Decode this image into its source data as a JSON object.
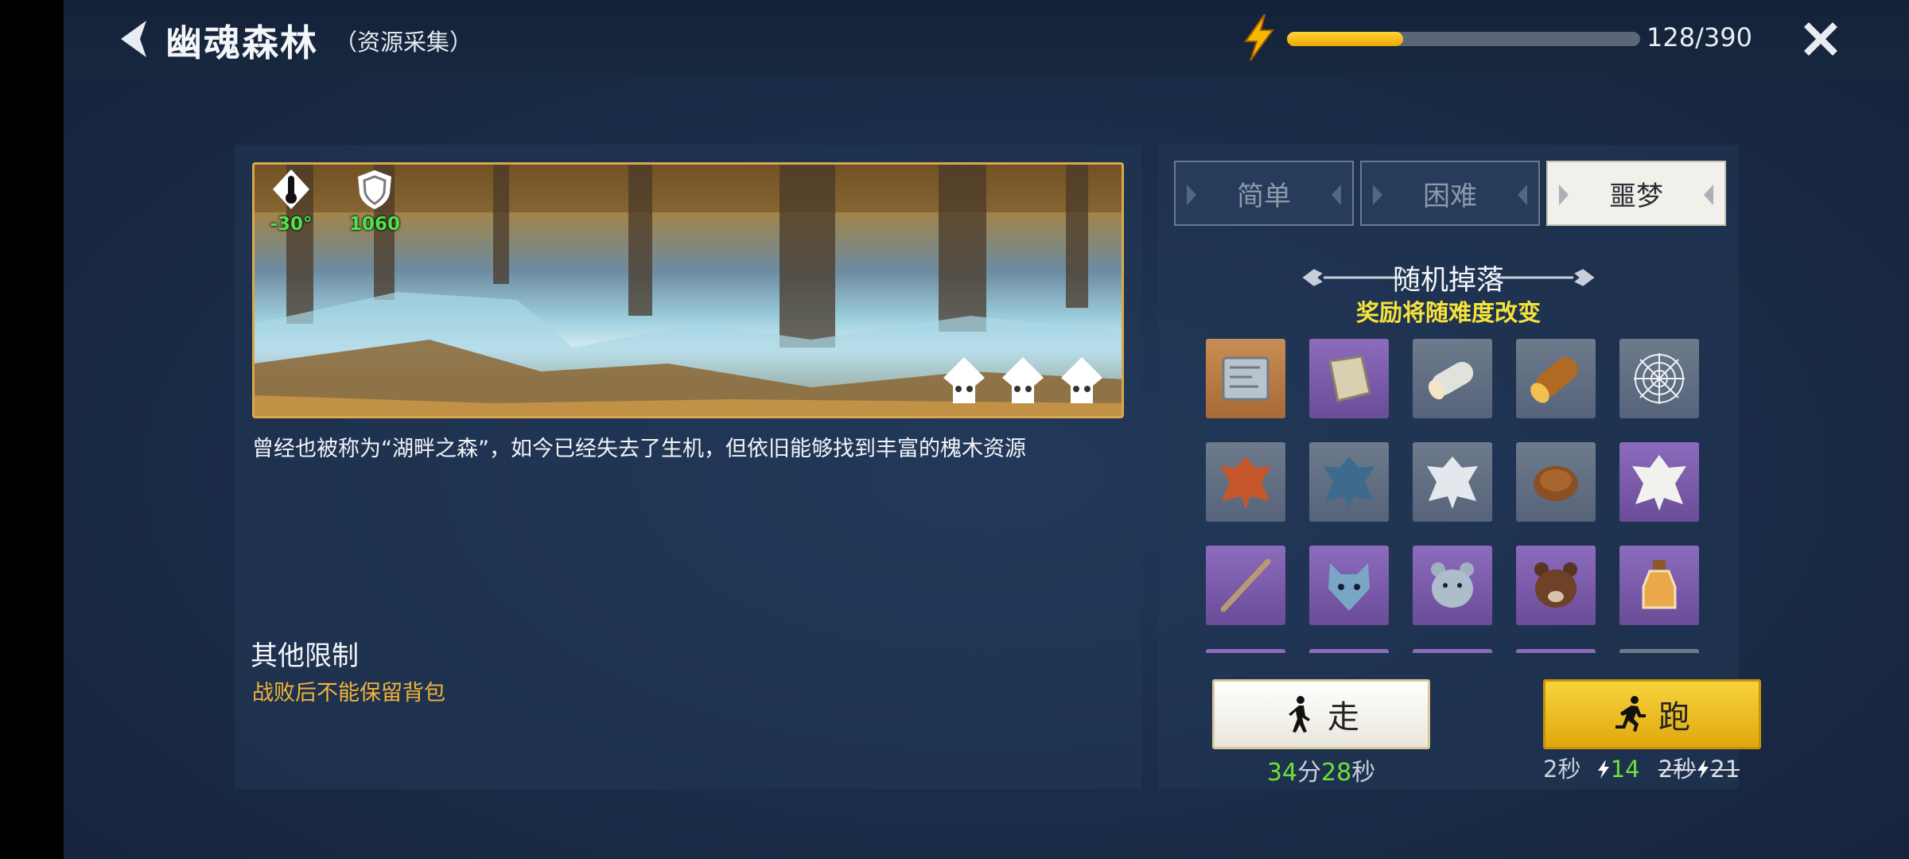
{
  "header": {
    "title": "幽魂森林",
    "subtitle": "（资源采集）",
    "energy": {
      "current_text": "128/390",
      "fraction": 0.328
    }
  },
  "stage": {
    "temperature": "-30°",
    "defense": "1060",
    "description": "曾经也被称为“湖畔之森”，如今已经失去了生机，但依旧能够找到丰富的槐木资源",
    "limits_title": "其他限制",
    "limits_text": "战败后不能保留背包"
  },
  "difficulty": {
    "tabs": [
      {
        "label": "简单",
        "active": false
      },
      {
        "label": "困难",
        "active": false
      },
      {
        "label": "噩梦",
        "active": true
      }
    ]
  },
  "drops": {
    "title": "随机掉落",
    "subtitle": "奖励将随难度改变",
    "items": [
      {
        "icon": "map-scroll-icon",
        "rarity": "orange"
      },
      {
        "icon": "parchment-icon",
        "rarity": "purple"
      },
      {
        "icon": "birch-log-icon",
        "rarity": "gray"
      },
      {
        "icon": "oak-log-icon",
        "rarity": "gray"
      },
      {
        "icon": "spiderweb-icon",
        "rarity": "gray"
      },
      {
        "icon": "fox-pelt-icon",
        "rarity": "gray"
      },
      {
        "icon": "wolf-pelt-icon",
        "rarity": "gray"
      },
      {
        "icon": "white-pelt-icon",
        "rarity": "gray"
      },
      {
        "icon": "fur-icon",
        "rarity": "gray"
      },
      {
        "icon": "polar-pelt-icon",
        "rarity": "purple"
      },
      {
        "icon": "stick-icon",
        "rarity": "purple"
      },
      {
        "icon": "wolf-head-icon",
        "rarity": "purple"
      },
      {
        "icon": "bear-head-icon",
        "rarity": "purple"
      },
      {
        "icon": "boar-head-icon",
        "rarity": "purple"
      },
      {
        "icon": "potion-icon",
        "rarity": "purple"
      }
    ]
  },
  "travel": {
    "walk_label": "走",
    "walk_minutes": "34",
    "walk_min_unit": "分",
    "walk_seconds": "28",
    "walk_sec_unit": "秒",
    "run_label": "跑",
    "run_time": "2秒",
    "run_cost": "14",
    "run_old_time": "2秒",
    "run_old_cost": "21"
  },
  "colors": {
    "accent_yellow": "#f2b33a",
    "green": "#6fe03a",
    "energy_fill": "#f5c11c"
  }
}
